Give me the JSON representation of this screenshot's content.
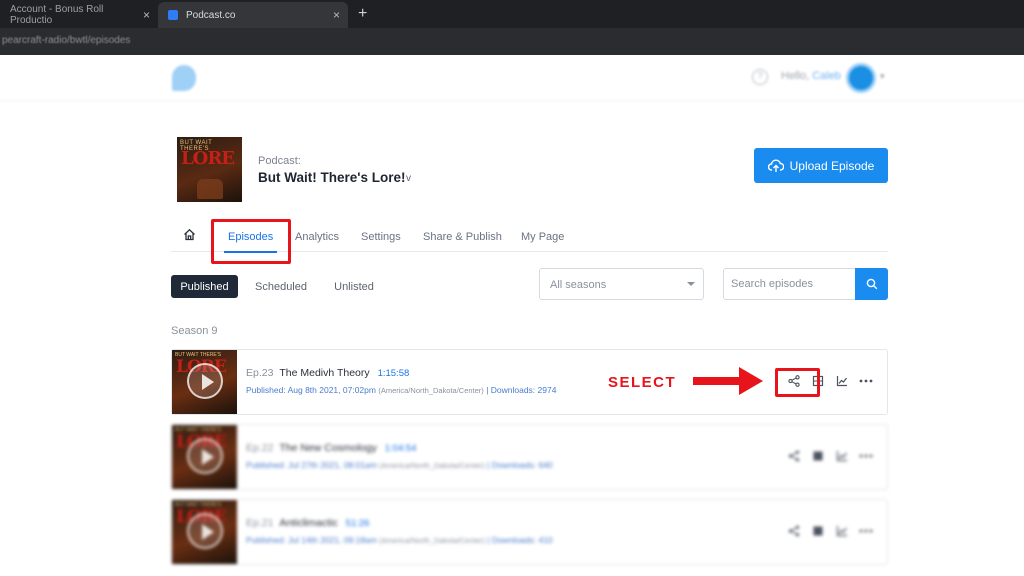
{
  "browser": {
    "tabs": [
      {
        "label": "Account - Bonus Roll Productio"
      },
      {
        "label": "Podcast.co"
      }
    ],
    "url": "pearcraft-radio/bwtl/episodes"
  },
  "header": {
    "hello_text": "Hello,",
    "user_name": "Caleb"
  },
  "podcast": {
    "label": "Podcast:",
    "title": "But Wait! There's Lore!",
    "title_caret": "v",
    "cover_top_text": "BUT WAIT THERE'S",
    "cover_main_text": "LORE",
    "upload_label": "Upload Episode"
  },
  "nav": {
    "tabs": [
      {
        "label": "Episodes"
      },
      {
        "label": "Analytics"
      },
      {
        "label": "Settings"
      },
      {
        "label": "Share & Publish"
      },
      {
        "label": "My Page"
      }
    ]
  },
  "filters": {
    "segments": [
      {
        "label": "Published"
      },
      {
        "label": "Scheduled"
      },
      {
        "label": "Unlisted"
      }
    ],
    "season_select": "All seasons",
    "search_placeholder": "Search episodes"
  },
  "season_label": "Season 9",
  "episodes": [
    {
      "num": "Ep.23",
      "title": "The Medivh Theory",
      "duration": "1:15:58",
      "published": "Published: Aug 8th 2021, 07:02pm",
      "timezone": "(America/North_Dakota/Center)",
      "downloads": "| Downloads: 2974"
    },
    {
      "num": "Ep.22",
      "title": "The New Cosmology",
      "duration": "1:04:54",
      "published": "Published: Jul 27th 2021, 08:01am",
      "timezone": "(America/North_Dakota/Center)",
      "downloads": "| Downloads: 640"
    },
    {
      "num": "Ep.21",
      "title": "Anticlimactic",
      "duration": "51:26",
      "published": "Published: Jul 14th 2021, 09:18am",
      "timezone": "(America/North_Dakota/Center)",
      "downloads": "| Downloads: 410"
    }
  ],
  "annotation": {
    "callout": "SELECT",
    "color": "#e8141b"
  },
  "colors": {
    "accent": "#1a8cf0",
    "active_tab": "#1a73e8",
    "dark_segment": "#1f2937"
  }
}
